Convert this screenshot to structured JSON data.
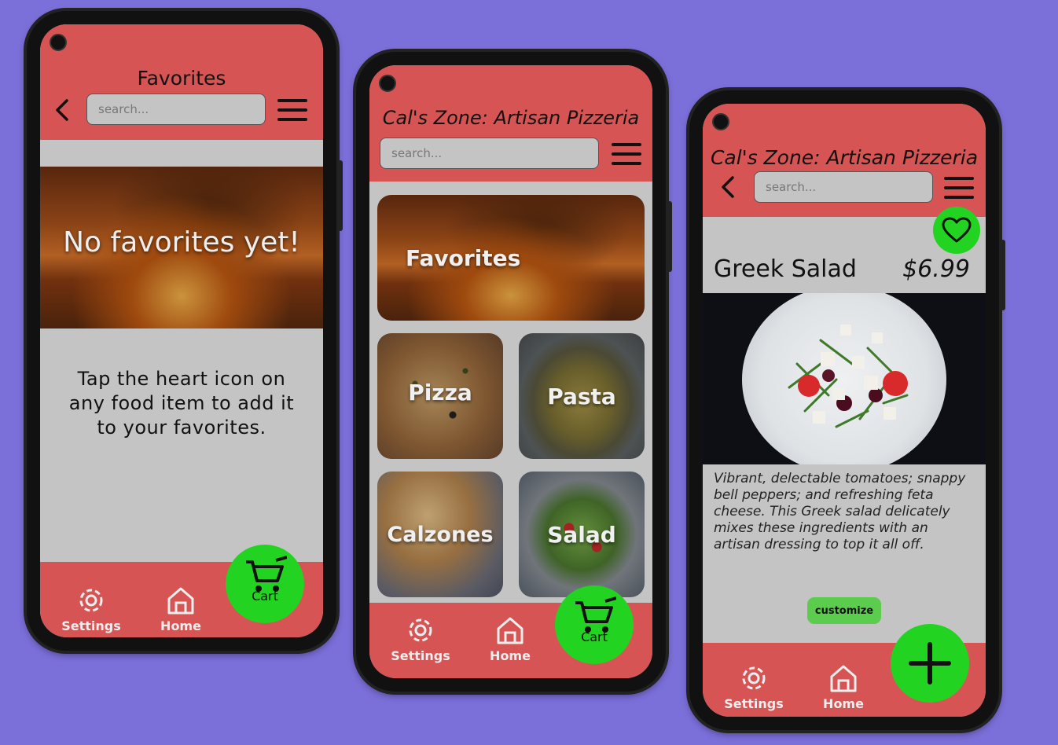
{
  "screens": {
    "favorites": {
      "title": "Favorites",
      "search_placeholder": "search...",
      "hero_text": "No favorites yet!",
      "instructions": "Tap the heart icon on any food item to add it to your favorites.",
      "nav": {
        "settings": "Settings",
        "home": "Home"
      },
      "fab_label": "Cart"
    },
    "home": {
      "title": "Cal's Zone: Artisan Pizzeria",
      "search_placeholder": "search...",
      "categories": [
        "Favorites",
        "Pizza",
        "Pasta",
        "Calzones",
        "Salad"
      ],
      "nav": {
        "settings": "Settings",
        "home": "Home"
      },
      "fab_label": "Cart"
    },
    "item": {
      "title": "Cal's Zone: Artisan Pizzeria",
      "search_placeholder": "search...",
      "item_name": "Greek Salad",
      "item_price": "$6.99",
      "description": "Vibrant, delectable tomatoes; snappy bell peppers; and refreshing feta cheese. This Greek salad delicately mixes these ingredients with an artisan dressing to top it all off.",
      "customize_label": "customize",
      "nav": {
        "settings": "Settings",
        "home": "Home"
      }
    }
  },
  "colors": {
    "background": "#7b6fd9",
    "header": "#d75454",
    "content": "#c4c4c4",
    "fab": "#22d322",
    "customize": "#5bcc4e"
  }
}
